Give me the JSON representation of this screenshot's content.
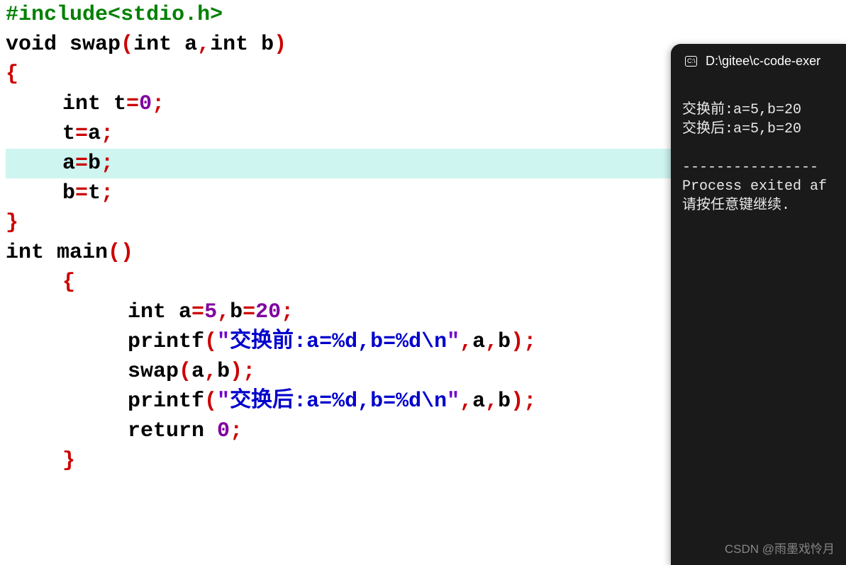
{
  "code": {
    "l1": {
      "hash": "#",
      "include": "include",
      "lt": "<",
      "hdr": "stdio.h",
      "gt": ">"
    },
    "l2": {
      "kw_void": "void",
      "sp1": " ",
      "fn": "swap",
      "lp": "(",
      "kw_int1": "int",
      "sp2": " ",
      "a": "a",
      "comma": ",",
      "kw_int2": "int",
      "sp3": " ",
      "b": "b",
      "rp": ")"
    },
    "l3": {
      "brace": "{"
    },
    "l4": {
      "kw_int": "int",
      "sp": " ",
      "var": "t",
      "eq": "=",
      "num": "0",
      "semi": ";"
    },
    "l5": {
      "lhs": "t",
      "eq": "=",
      "rhs": "a",
      "semi": ";"
    },
    "l6": {
      "lhs": "a",
      "eq": "=",
      "rhs": "b",
      "semi": ";"
    },
    "l7": {
      "lhs": "b",
      "eq": "=",
      "rhs": "t",
      "semi": ";"
    },
    "l8": {
      "brace": "}"
    },
    "l9": {
      "kw_int": "int",
      "sp": " ",
      "fn": "main",
      "lp": "(",
      "rp": ")"
    },
    "l10": {
      "brace": "{"
    },
    "l11": {
      "kw_int": "int",
      "sp": " ",
      "a": "a",
      "eq1": "=",
      "n1": "5",
      "comma": ",",
      "b": "b",
      "eq2": "=",
      "n2": "20",
      "semi": ";"
    },
    "l12": {
      "fn": "printf",
      "lp": "(",
      "q1": "\"",
      "zh": "交换前",
      "fmt": ":a=%d,b=%d\\n",
      "q2": "\"",
      "comma1": ",",
      "a": "a",
      "comma2": ",",
      "b": "b",
      "rp": ")",
      "semi": ";"
    },
    "l13": {
      "fn": "swap",
      "lp": "(",
      "a": "a",
      "comma": ",",
      "b": "b",
      "rp": ")",
      "semi": ";"
    },
    "l14": {
      "fn": "printf",
      "lp": "(",
      "q1": "\"",
      "zh": "交换后",
      "fmt": ":a=%d,b=%d\\n",
      "q2": "\"",
      "comma1": ",",
      "a": "a",
      "comma2": ",",
      "b": "b",
      "rp": ")",
      "semi": ";"
    },
    "l15": {
      "kw": "return",
      "sp": " ",
      "n": "0",
      "semi": ";"
    },
    "l16": {
      "brace": "}"
    }
  },
  "terminal": {
    "title": "D:\\gitee\\c-code-exer",
    "icon_glyph": "C:\\",
    "out1": "交换前:a=5,b=20",
    "out2": "交换后:a=5,b=20",
    "blank": "",
    "sep": "----------------",
    "proc": "Process exited af",
    "press": "请按任意键继续. "
  },
  "watermark": "CSDN @雨墨戏怜月"
}
